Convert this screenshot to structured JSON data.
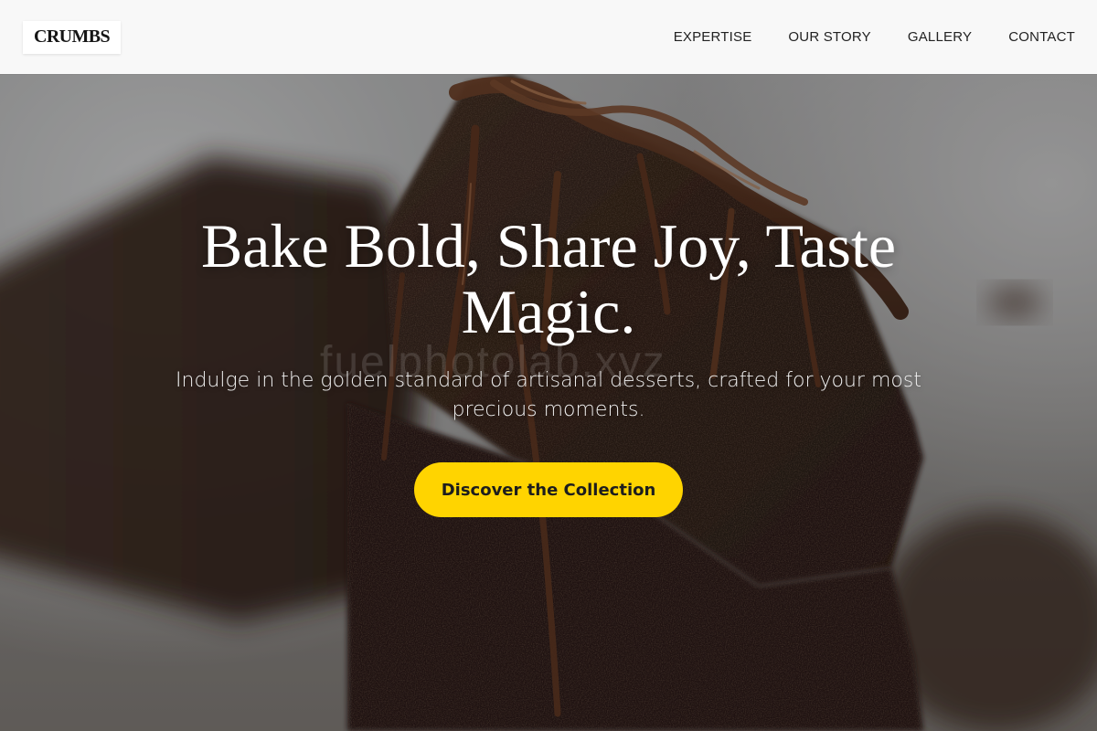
{
  "header": {
    "logo": "CRUMBS",
    "nav": [
      {
        "label": "EXPERTISE"
      },
      {
        "label": "OUR STORY"
      },
      {
        "label": "GALLERY"
      },
      {
        "label": "CONTACT"
      }
    ]
  },
  "hero": {
    "title": "Bake Bold, Share Joy, Taste Magic.",
    "subtitle": "Indulge in the golden standard of artisanal desserts, crafted for your most precious moments.",
    "cta_label": "Discover the Collection",
    "watermark": "fuelphotolab.xyz",
    "background_image": "chocolate-cake-slice-photo"
  },
  "colors": {
    "header_bg": "#f8f8f8",
    "cta_bg": "#ffd400",
    "cta_text": "#1d1d1d",
    "hero_text": "#ffffff"
  }
}
